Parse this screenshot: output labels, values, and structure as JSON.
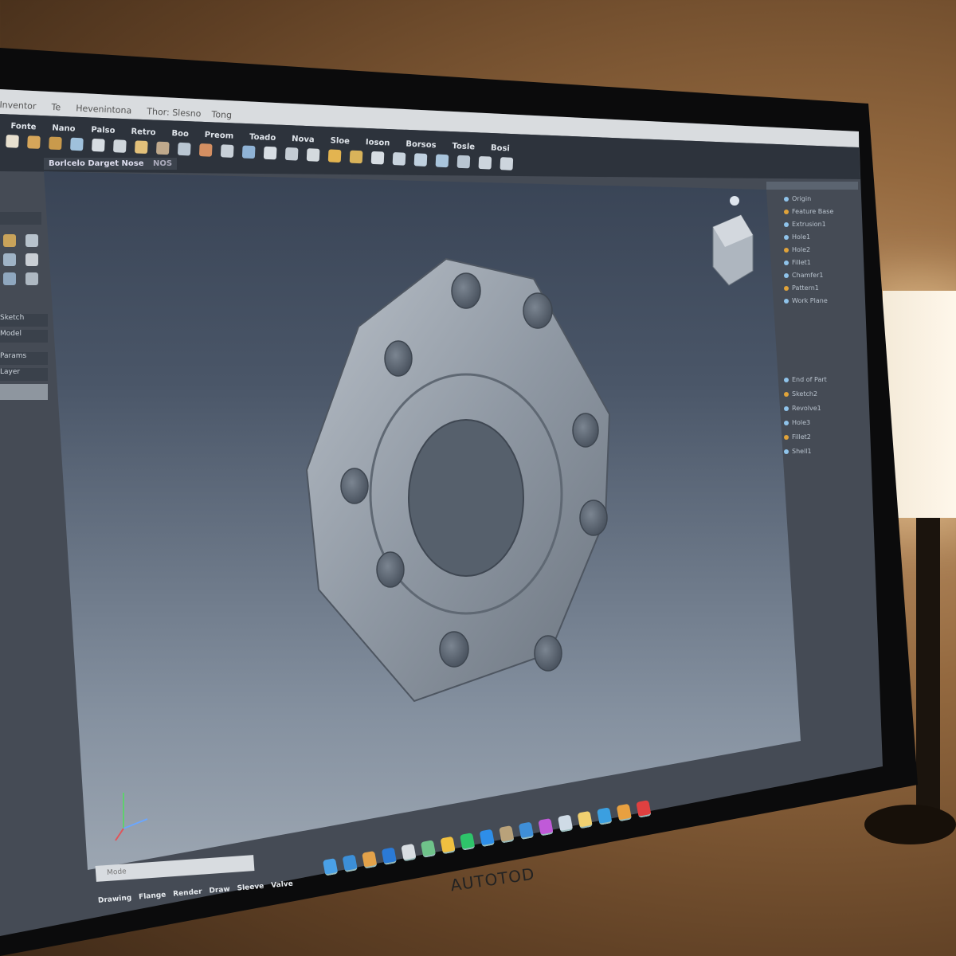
{
  "window": {
    "title_parts": [
      "Inventor",
      "Te",
      "Hevenintona",
      "Thor: Slesno",
      "Tong"
    ]
  },
  "menu": [
    "Fonte",
    "Nano",
    "Palso",
    "Retro",
    "Boo",
    "Preom",
    "Toado",
    "Nova",
    "Sloe",
    "Ioson",
    "Borsos",
    "Tosle",
    "Bosi"
  ],
  "toolbar_icons": [
    "sphere-icon",
    "part-icon",
    "assembly-icon",
    "gear-icon",
    "pin-icon",
    "sketch-icon",
    "pencil-icon",
    "extrude-icon",
    "fillet-icon",
    "revolve-icon",
    "frame-icon",
    "hole-icon",
    "shell-icon",
    "pattern-icon",
    "view-icon",
    "mirror-icon",
    "constraint-icon",
    "inspect-icon",
    "table-icon",
    "grid-icon",
    "dimension-icon",
    "measure-icon",
    "loop-icon",
    "arrow-icon"
  ],
  "document_tab": {
    "label": "Borlcelo Darget Nose",
    "extra": "NOS"
  },
  "left_panel": {
    "rows": [
      "Sketch",
      "Model",
      "Params",
      "Layer"
    ]
  },
  "right_panel": {
    "tree": [
      "Origin",
      "Feature Base",
      "Extrusion1",
      "Hole1",
      "Hole2",
      "Fillet1",
      "Chamfer1",
      "Pattern1",
      "Work Plane",
      "End of Part",
      "Sketch2",
      "Revolve1",
      "Hole3",
      "Fillet2",
      "Shell1"
    ]
  },
  "command_line": {
    "placeholder": "Mode"
  },
  "bottom_tabs": [
    "Drawing",
    "Flange",
    "Render",
    "Draw",
    "Sleeve",
    "Valve"
  ],
  "taskbar_icons": [
    "start-icon",
    "search-icon",
    "files-icon",
    "word-icon",
    "terminal-icon",
    "sheets-icon",
    "folder-icon",
    "chat-icon",
    "browser-icon",
    "settings-icon",
    "mail-icon",
    "paint-icon",
    "photos-icon",
    "notes-icon",
    "calendar-icon",
    "store-icon",
    "record-icon"
  ],
  "bezel_brand": "AUTOTOD",
  "colors": {
    "viewport_top": "#2b3546",
    "viewport_bottom": "#a9b2bc",
    "part": "#9aa3ad",
    "menubar": "#2d333c"
  }
}
